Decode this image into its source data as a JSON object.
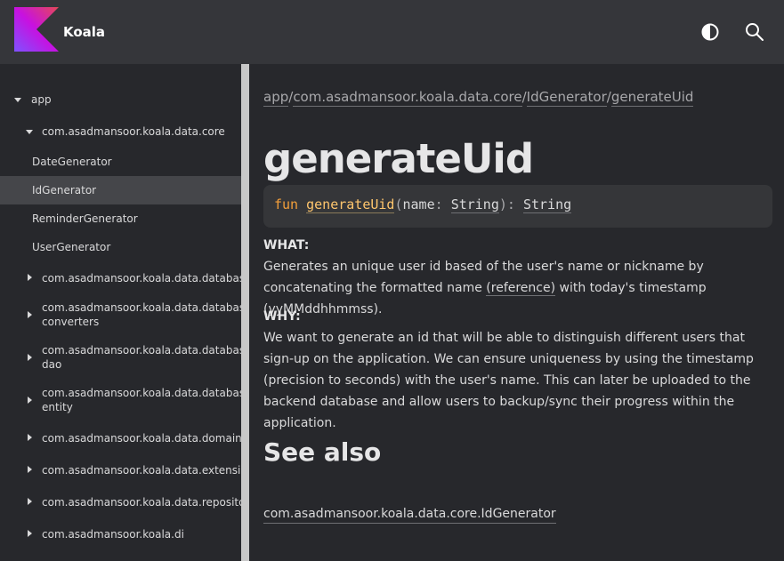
{
  "header": {
    "app_title": "Koala",
    "theme_icon": "contrast-icon",
    "search_icon": "search-icon",
    "logo_colors": [
      "#7f52ff",
      "#c711e1",
      "#e44857"
    ]
  },
  "sidebar": {
    "root": "app",
    "package": "com.asadmansoor.koala.data.core",
    "classes": [
      "DateGenerator",
      "IdGenerator",
      "ReminderGenerator",
      "UserGenerator"
    ],
    "selected": "IdGenerator",
    "packages": [
      "com.asadmansoor.koala.data.database",
      "com.asadmansoor.koala.data.database.",
      "converters",
      "com.asadmansoor.koala.data.database.",
      "dao",
      "com.asadmansoor.koala.data.database.",
      "entity",
      "com.asadmansoor.koala.data.domain",
      "com.asadmansoor.koala.data.extensions",
      "com.asadmansoor.koala.data.repository",
      "com.asadmansoor.koala.di"
    ]
  },
  "breadcrumb": {
    "parts": [
      "app",
      "com.asadmansoor.koala.data.core",
      "IdGenerator",
      "generateUid"
    ],
    "separator": "/"
  },
  "content": {
    "title": "generateUid",
    "signature": {
      "keyword": "fun",
      "name": "generateUid",
      "open": "(",
      "param_name": "name",
      "colon1": ": ",
      "param_type": "String",
      "close": "): ",
      "return_type": "String"
    },
    "what_label": "WHAT:",
    "what_text_1": "Generates an unique user id based of the user's name or nickname by concatenating the formatted name ",
    "what_link": "(reference)",
    "what_text_2": " with today's timestamp (yyMMddhhmmss).",
    "why_label": "WHY:",
    "why_text": "We want to generate an id that will be able to distinguish different users that sign-up on the application. We can ensure uniqueness by using the timestamp (precision to seconds) with the user's name. This can later be uploaded to the backend database and allow users to backup/sync their progress within the application.",
    "see_also_title": "See also",
    "see_also_link": "com.asadmansoor.koala.data.core.IdGenerator"
  }
}
